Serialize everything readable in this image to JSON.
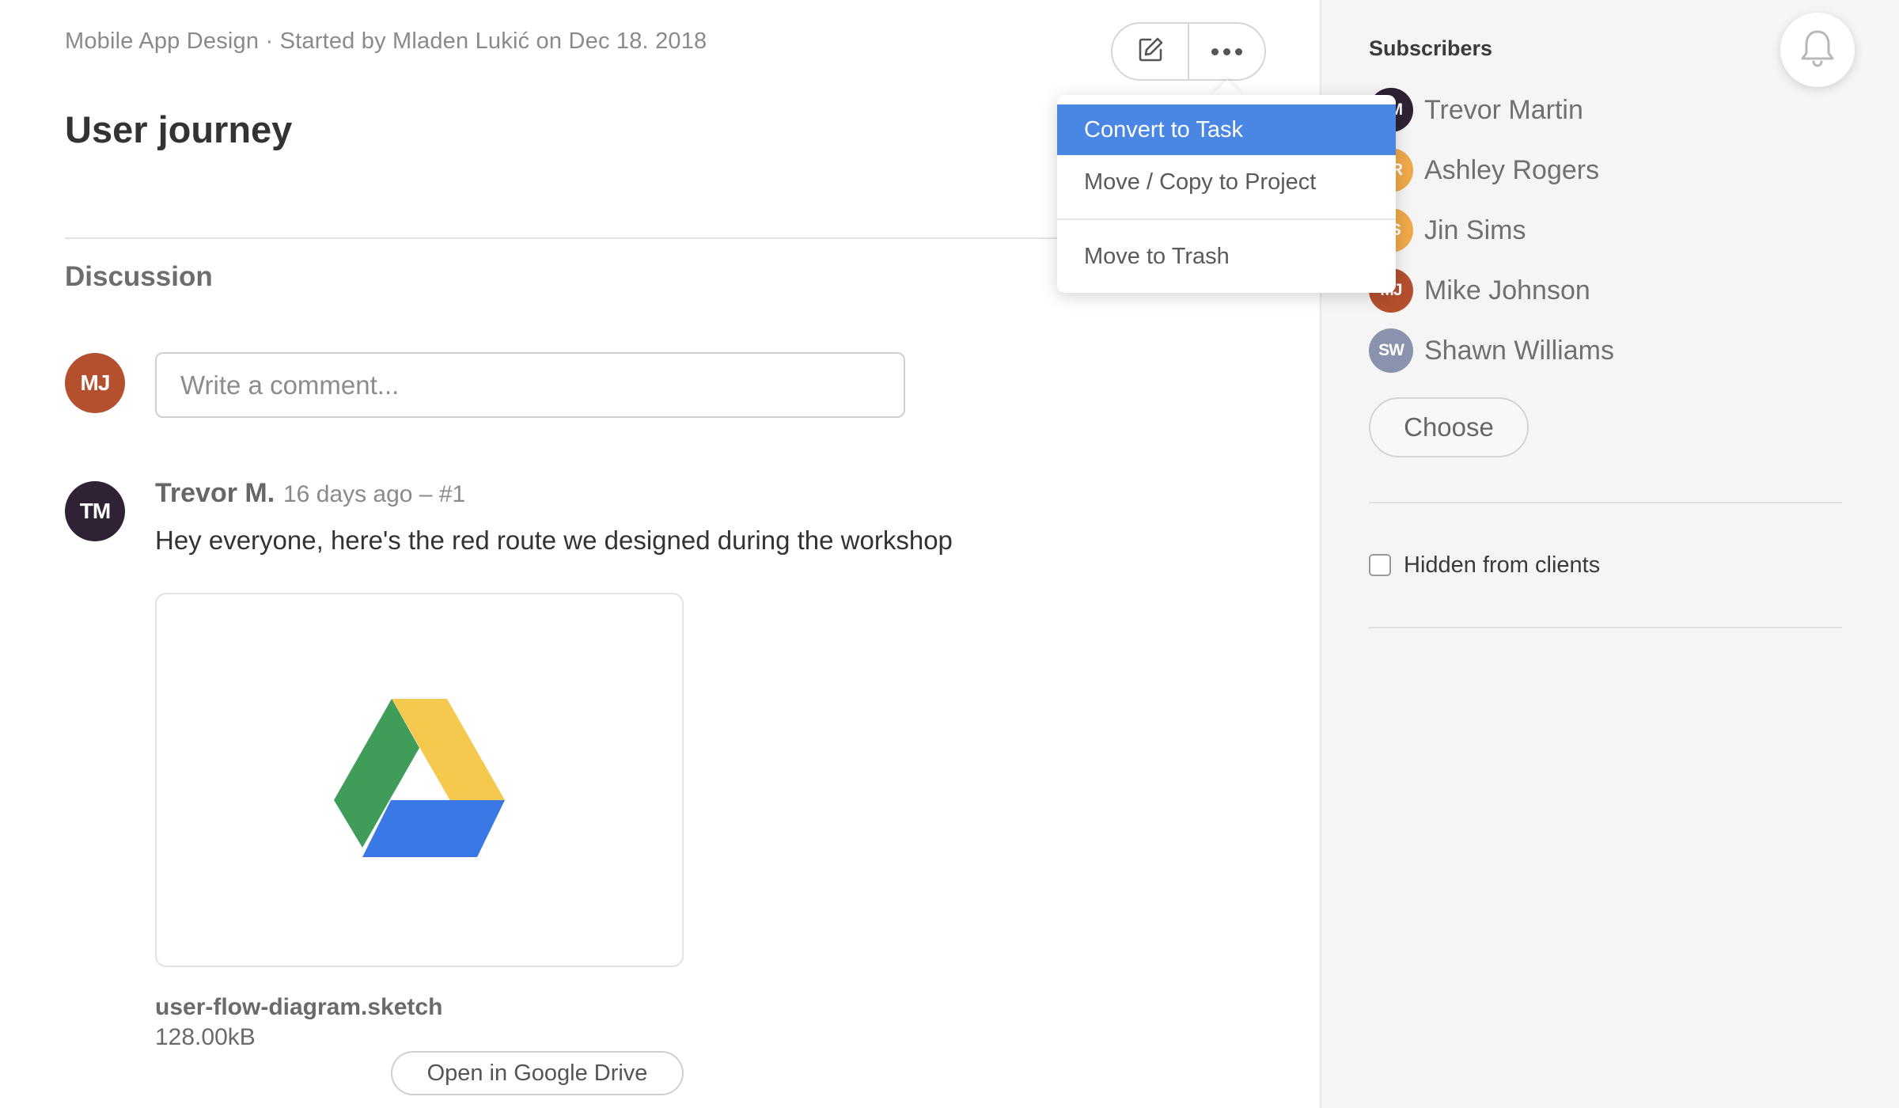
{
  "header": {
    "breadcrumb": "Mobile App Design · Started by Mladen Lukić on Dec 18. 2018",
    "title": "User journey",
    "edit_icon": "edit-icon",
    "more_icon": "more-dots-icon"
  },
  "menu": {
    "items": [
      {
        "label": "Convert to Task"
      },
      {
        "label": "Move / Copy to Project"
      },
      {
        "label": "Move to Trash"
      }
    ],
    "highlight_color": "#4a86e4"
  },
  "discussion": {
    "title": "Discussion",
    "current_user_initials": "MJ",
    "comment_placeholder": "Write a comment...",
    "comments": [
      {
        "initials": "TM",
        "author": "Trevor M.",
        "meta": "16 days ago – #1",
        "text": "Hey everyone, here's the red route we designed during the workshop",
        "attachment": {
          "icon": "google-drive-icon",
          "file_name": "user-flow-diagram.sketch",
          "file_size": "128.00kB",
          "open_label": "Open in Google Drive"
        }
      }
    ]
  },
  "sidebar": {
    "title": "Subscribers",
    "bell_icon": "bell-icon",
    "subscribers": [
      {
        "initials": "TM",
        "name": "Trevor Martin",
        "color": "#2e2234"
      },
      {
        "initials": "AR",
        "name": "Ashley Rogers",
        "color": "#f0a94a"
      },
      {
        "initials": "JS",
        "name": "Jin Sims",
        "color": "#f0a94a"
      },
      {
        "initials": "MJ",
        "name": "Mike Johnson",
        "color": "#b5502e"
      },
      {
        "initials": "SW",
        "name": "Shawn Williams",
        "color": "#8a92ad"
      }
    ],
    "choose_label": "Choose",
    "hidden_label": "Hidden from clients",
    "hidden_checked": false
  }
}
